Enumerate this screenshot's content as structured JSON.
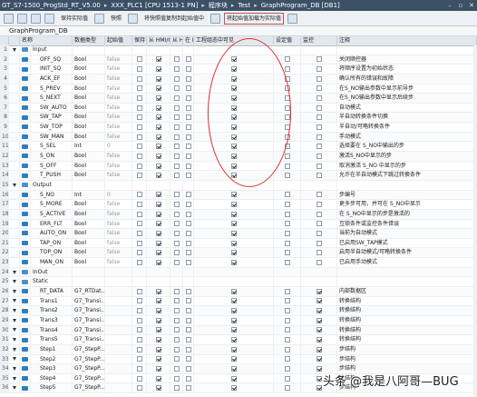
{
  "titlebar": {
    "segments": [
      "GT_S7-1500_ProgStd_RT_V5.00",
      "XXX_PLC1 [CPU 1513-1 PN]",
      "程序块",
      "Test",
      "GraphProgram_DB [DB1]"
    ],
    "separator": "▸"
  },
  "toolbar": {
    "buttons": [
      "保持实际值",
      "快照",
      "将快照值复制到起始值中",
      "将起始值加载为实际值"
    ]
  },
  "block_title": "GraphProgram_DB",
  "columns": {
    "name": "名称",
    "type": "数据类型",
    "start": "起始值",
    "keep": "保持",
    "hmi1": "从 HMI/OPC..",
    "hmi2": "从 H..",
    "in": "在 HMI..",
    "eng": "工程组态中可见",
    "set": "设定值",
    "mon": "监控",
    "comment": "注释"
  },
  "rows": [
    {
      "num": "1",
      "kind": "section",
      "name": "Input",
      "type": "",
      "start": "",
      "keep": false,
      "hmi1": false,
      "hmi2": false,
      "in": false,
      "eng": false,
      "set": false,
      "mon": false,
      "comment": ""
    },
    {
      "num": "2",
      "kind": "var",
      "name": "OFF_SQ",
      "type": "Bool",
      "start": "false",
      "keep": false,
      "hmi1": true,
      "hmi2": false,
      "in": false,
      "eng": true,
      "set": false,
      "mon": false,
      "comment": "关闭顺控器"
    },
    {
      "num": "3",
      "kind": "var",
      "name": "INIT_SQ",
      "type": "Bool",
      "start": "false",
      "keep": false,
      "hmi1": true,
      "hmi2": false,
      "in": false,
      "eng": true,
      "set": false,
      "mon": false,
      "comment": "将顺序设置为初始状态"
    },
    {
      "num": "4",
      "kind": "var",
      "name": "ACK_EF",
      "type": "Bool",
      "start": "false",
      "keep": false,
      "hmi1": true,
      "hmi2": false,
      "in": false,
      "eng": true,
      "set": false,
      "mon": false,
      "comment": "确认所有的错误和故障"
    },
    {
      "num": "5",
      "kind": "var",
      "name": "S_PREV",
      "type": "Bool",
      "start": "false",
      "keep": false,
      "hmi1": true,
      "hmi2": false,
      "in": false,
      "eng": true,
      "set": false,
      "mon": false,
      "comment": "在S_NO输出参数中显示前导步"
    },
    {
      "num": "6",
      "kind": "var",
      "name": "S_NEXT",
      "type": "Bool",
      "start": "false",
      "keep": false,
      "hmi1": true,
      "hmi2": false,
      "in": false,
      "eng": true,
      "set": false,
      "mon": false,
      "comment": "在S_NO输出参数中显示后续步"
    },
    {
      "num": "7",
      "kind": "var",
      "name": "SW_AUTO",
      "type": "Bool",
      "start": "false",
      "keep": false,
      "hmi1": true,
      "hmi2": false,
      "in": false,
      "eng": true,
      "set": false,
      "mon": false,
      "comment": "自动模式"
    },
    {
      "num": "8",
      "kind": "var",
      "name": "SW_TAP",
      "type": "Bool",
      "start": "false",
      "keep": false,
      "hmi1": true,
      "hmi2": false,
      "in": false,
      "eng": true,
      "set": false,
      "mon": false,
      "comment": "半自动转换条件切换"
    },
    {
      "num": "9",
      "kind": "var",
      "name": "SW_TOP",
      "type": "Bool",
      "start": "false",
      "keep": false,
      "hmi1": true,
      "hmi2": false,
      "in": false,
      "eng": true,
      "set": false,
      "mon": false,
      "comment": "半自动/可略转换条件"
    },
    {
      "num": "10",
      "kind": "var",
      "name": "SW_MAN",
      "type": "Bool",
      "start": "false",
      "keep": false,
      "hmi1": true,
      "hmi2": false,
      "in": false,
      "eng": true,
      "set": false,
      "mon": false,
      "comment": "手动模式"
    },
    {
      "num": "11",
      "kind": "var",
      "name": "S_SEL",
      "type": "Int",
      "start": "0",
      "keep": false,
      "hmi1": true,
      "hmi2": false,
      "in": false,
      "eng": true,
      "set": false,
      "mon": false,
      "comment": "选择要在 S_NO中输出的步"
    },
    {
      "num": "12",
      "kind": "var",
      "name": "S_ON",
      "type": "Bool",
      "start": "false",
      "keep": false,
      "hmi1": true,
      "hmi2": false,
      "in": false,
      "eng": true,
      "set": false,
      "mon": false,
      "comment": "激活S_NO中显示的步"
    },
    {
      "num": "13",
      "kind": "var",
      "name": "S_OFF",
      "type": "Bool",
      "start": "false",
      "keep": false,
      "hmi1": true,
      "hmi2": false,
      "in": false,
      "eng": true,
      "set": false,
      "mon": false,
      "comment": "取消激活 S_NO 中显示的步"
    },
    {
      "num": "14",
      "kind": "var",
      "name": "T_PUSH",
      "type": "Bool",
      "start": "false",
      "keep": false,
      "hmi1": true,
      "hmi2": false,
      "in": false,
      "eng": true,
      "set": false,
      "mon": false,
      "comment": "允许在半自动模式下跳过转换条件"
    },
    {
      "num": "15",
      "kind": "section",
      "name": "Output",
      "type": "",
      "start": "",
      "keep": false,
      "hmi1": false,
      "hmi2": false,
      "in": false,
      "eng": false,
      "set": false,
      "mon": false,
      "comment": ""
    },
    {
      "num": "16",
      "kind": "var",
      "name": "S_NO",
      "type": "Int",
      "start": "0",
      "keep": false,
      "hmi1": true,
      "hmi2": false,
      "in": false,
      "eng": true,
      "set": false,
      "mon": false,
      "comment": "步编号"
    },
    {
      "num": "17",
      "kind": "var",
      "name": "S_MORE",
      "type": "Bool",
      "start": "false",
      "keep": false,
      "hmi1": true,
      "hmi2": false,
      "in": false,
      "eng": true,
      "set": false,
      "mon": false,
      "comment": "更多步可用，并可在 S_NO中显示"
    },
    {
      "num": "18",
      "kind": "var",
      "name": "S_ACTIVE",
      "type": "Bool",
      "start": "false",
      "keep": false,
      "hmi1": true,
      "hmi2": false,
      "in": false,
      "eng": true,
      "set": false,
      "mon": false,
      "comment": "在 S_NO中显示的步是激活的"
    },
    {
      "num": "19",
      "kind": "var",
      "name": "ERR_FLT",
      "type": "Bool",
      "start": "false",
      "keep": false,
      "hmi1": true,
      "hmi2": false,
      "in": false,
      "eng": true,
      "set": false,
      "mon": false,
      "comment": "互锁条件或监控条件错误"
    },
    {
      "num": "20",
      "kind": "var",
      "name": "AUTO_ON",
      "type": "Bool",
      "start": "false",
      "keep": false,
      "hmi1": true,
      "hmi2": false,
      "in": false,
      "eng": true,
      "set": false,
      "mon": false,
      "comment": "当前为自动模式"
    },
    {
      "num": "21",
      "kind": "var",
      "name": "TAP_ON",
      "type": "Bool",
      "start": "false",
      "keep": false,
      "hmi1": true,
      "hmi2": false,
      "in": false,
      "eng": true,
      "set": false,
      "mon": false,
      "comment": "已启用SW_TAP模式"
    },
    {
      "num": "22",
      "kind": "var",
      "name": "TOP_ON",
      "type": "Bool",
      "start": "false",
      "keep": false,
      "hmi1": true,
      "hmi2": false,
      "in": false,
      "eng": true,
      "set": false,
      "mon": false,
      "comment": "启用半自动模式/可略转换条件"
    },
    {
      "num": "23",
      "kind": "var",
      "name": "MAN_ON",
      "type": "Bool",
      "start": "false",
      "keep": false,
      "hmi1": true,
      "hmi2": false,
      "in": false,
      "eng": true,
      "set": false,
      "mon": false,
      "comment": "已启用手动模式"
    },
    {
      "num": "24",
      "kind": "section",
      "name": "InOut",
      "type": "",
      "start": "",
      "keep": false,
      "hmi1": false,
      "hmi2": false,
      "in": false,
      "eng": false,
      "set": false,
      "mon": false,
      "comment": ""
    },
    {
      "num": "25",
      "kind": "section",
      "name": "Static",
      "type": "",
      "start": "",
      "keep": false,
      "hmi1": false,
      "hmi2": false,
      "in": false,
      "eng": false,
      "set": false,
      "mon": false,
      "comment": ""
    },
    {
      "num": "26",
      "kind": "struct",
      "name": "RT_DATA",
      "type": "G7_RTDat...",
      "start": "",
      "keep": false,
      "hmi1": true,
      "hmi2": false,
      "in": false,
      "eng": true,
      "set": false,
      "mon": true,
      "comment": "内部数据区"
    },
    {
      "num": "27",
      "kind": "struct",
      "name": "Trans1",
      "type": "G7_Transi...",
      "start": "",
      "keep": false,
      "hmi1": true,
      "hmi2": false,
      "in": false,
      "eng": true,
      "set": false,
      "mon": true,
      "comment": "转换结构"
    },
    {
      "num": "28",
      "kind": "struct",
      "name": "Trans2",
      "type": "G7_Transi...",
      "start": "",
      "keep": false,
      "hmi1": true,
      "hmi2": false,
      "in": false,
      "eng": true,
      "set": false,
      "mon": true,
      "comment": "转换结构"
    },
    {
      "num": "29",
      "kind": "struct",
      "name": "Trans3",
      "type": "G7_Transi...",
      "start": "",
      "keep": false,
      "hmi1": true,
      "hmi2": false,
      "in": false,
      "eng": true,
      "set": false,
      "mon": true,
      "comment": "转换结构"
    },
    {
      "num": "30",
      "kind": "struct",
      "name": "Trans4",
      "type": "G7_Transi...",
      "start": "",
      "keep": false,
      "hmi1": true,
      "hmi2": false,
      "in": false,
      "eng": true,
      "set": false,
      "mon": true,
      "comment": "转换结构"
    },
    {
      "num": "31",
      "kind": "struct",
      "name": "Trans5",
      "type": "G7_Transi...",
      "start": "",
      "keep": false,
      "hmi1": true,
      "hmi2": false,
      "in": false,
      "eng": true,
      "set": false,
      "mon": true,
      "comment": "转换结构"
    },
    {
      "num": "32",
      "kind": "struct",
      "name": "Step1",
      "type": "G7_StepP...",
      "start": "",
      "keep": false,
      "hmi1": true,
      "hmi2": false,
      "in": false,
      "eng": true,
      "set": false,
      "mon": true,
      "comment": "步结构"
    },
    {
      "num": "33",
      "kind": "struct",
      "name": "Step2",
      "type": "G7_StepP...",
      "start": "",
      "keep": false,
      "hmi1": true,
      "hmi2": false,
      "in": false,
      "eng": true,
      "set": false,
      "mon": true,
      "comment": "步结构"
    },
    {
      "num": "34",
      "kind": "struct",
      "name": "Step3",
      "type": "G7_StepP...",
      "start": "",
      "keep": false,
      "hmi1": true,
      "hmi2": false,
      "in": false,
      "eng": true,
      "set": false,
      "mon": true,
      "comment": "步结构"
    },
    {
      "num": "35",
      "kind": "struct",
      "name": "Step4",
      "type": "G7_StepP...",
      "start": "",
      "keep": false,
      "hmi1": true,
      "hmi2": false,
      "in": false,
      "eng": true,
      "set": false,
      "mon": true,
      "comment": "步结构"
    },
    {
      "num": "36",
      "kind": "struct",
      "name": "Step5",
      "type": "G7_StepP...",
      "start": "",
      "keep": false,
      "hmi1": true,
      "hmi2": false,
      "in": false,
      "eng": true,
      "set": false,
      "mon": true,
      "comment": "步结构"
    }
  ],
  "watermark": "头条 @我是八阿哥—BUG"
}
